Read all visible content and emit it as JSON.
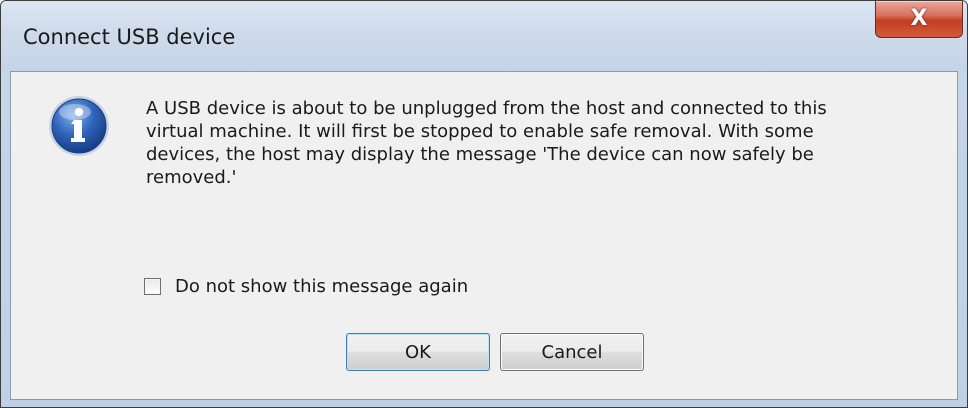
{
  "window": {
    "title": "Connect USB device",
    "close_glyph": "X"
  },
  "dialog": {
    "icon": "info-icon",
    "message_lines": [
      "A USB device is about to be unplugged from the host and connected to this",
      "virtual machine. It will first be stopped to enable safe removal. With some",
      "devices, the host may display the message 'The device can now safely be",
      "removed.'"
    ],
    "checkbox": {
      "label": "Do not show this message again",
      "checked": false
    },
    "buttons": {
      "ok_label": "OK",
      "cancel_label": "Cancel"
    }
  },
  "colors": {
    "info_icon": "#2f63b8",
    "close_button": "#c23e22",
    "default_button_border": "#3c7fb1"
  }
}
